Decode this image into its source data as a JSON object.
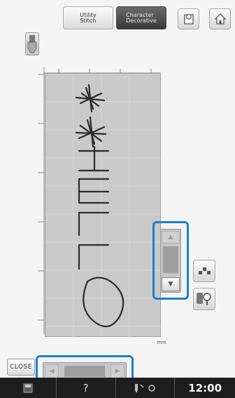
{
  "toolbar": {
    "utility_label": "Utility\nStitch",
    "character_label": "Character\nDecorative"
  },
  "side": {
    "close_label": "CLOSE",
    "unit_label": "mm"
  },
  "status": {
    "help_label": "?",
    "time": "12:00"
  },
  "colors": {
    "highlight": "#1a7fd3",
    "canvas": "#c9c9c9",
    "stitch": "#2b2b2b",
    "status_bar": "#1e1e1e"
  }
}
